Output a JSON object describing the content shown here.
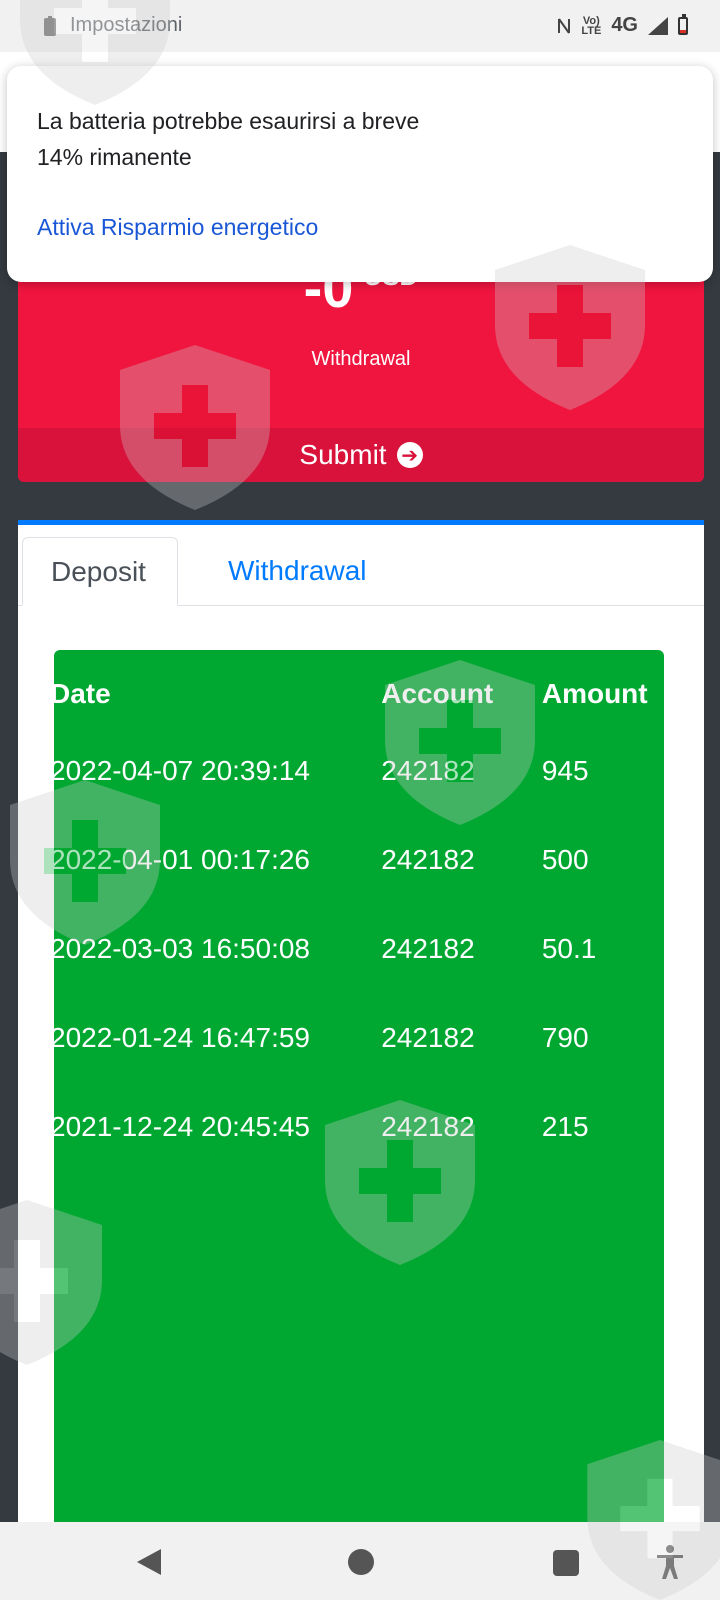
{
  "status_bar": {
    "app_label": "Impostazioni",
    "network": "4G",
    "volte": "VoLTE"
  },
  "notification": {
    "title": "La batteria potrebbe esaurirsi a breve",
    "subtitle": "14% rimanente",
    "action": "Attiva Risparmio energetico"
  },
  "withdraw_card": {
    "amount": "-0",
    "currency": "USD",
    "label": "Withdrawal",
    "submit": "Submit",
    "submit_icon": "arrow-right-circle-icon",
    "color": "#f0153f"
  },
  "tabs": [
    {
      "label": "Deposit",
      "active": true
    },
    {
      "label": "Withdrawal",
      "active": false
    }
  ],
  "table": {
    "columns": [
      "Date",
      "Account",
      "Amount"
    ],
    "rows": [
      [
        "2022-04-07 20:39:14",
        "242182",
        "945"
      ],
      [
        "2022-04-01 00:17:26",
        "242182",
        "500"
      ],
      [
        "2022-03-03 16:50:08",
        "242182",
        "50.1"
      ],
      [
        "2022-01-24 16:47:59",
        "242182",
        "790"
      ],
      [
        "2021-12-24 20:45:45",
        "242182",
        "215"
      ]
    ],
    "background": "#00a832"
  },
  "colors": {
    "accent": "#007bff",
    "page_bg": "#343a40"
  }
}
